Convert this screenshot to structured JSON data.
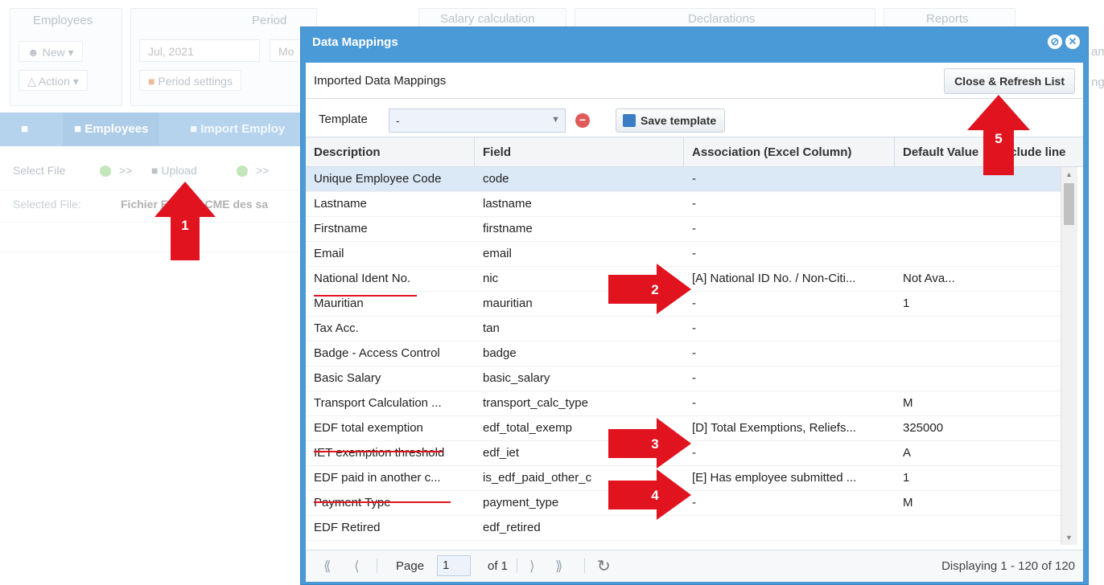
{
  "background": {
    "panels": {
      "employees": "Employees",
      "period": "Period",
      "salary_calculation": "Salary calculation",
      "declarations": "Declarations",
      "reports": "Reports"
    },
    "new_button": "New",
    "action_button": "Action",
    "period_value": "Jul, 2021",
    "period_mode": "Mo",
    "period_settings": "Period settings",
    "tabs": [
      "Employees",
      "Import Employ"
    ],
    "toolbar": {
      "select_file": "Select File",
      "sep1": ">>",
      "upload": "Upload",
      "sep2": ">>"
    },
    "selected_file_label": "Selected File:",
    "selected_file_value": "Fichier E... de ACME des sa",
    "right_edge_labels": [
      "am",
      "ng"
    ]
  },
  "modal": {
    "title": "Data Mappings",
    "subtitle": "Imported Data Mappings",
    "close_refresh_label": "Close & Refresh List",
    "template_label": "Template",
    "template_value": "-",
    "save_template_label": "Save template",
    "columns": [
      "Description",
      "Field",
      "Association (Excel Column)",
      "Default Value",
      "Include line"
    ],
    "rows": [
      {
        "description": "Unique Employee Code",
        "field": "code",
        "association": "-",
        "default": ""
      },
      {
        "description": "Lastname",
        "field": "lastname",
        "association": "-",
        "default": ""
      },
      {
        "description": "Firstname",
        "field": "firstname",
        "association": "-",
        "default": ""
      },
      {
        "description": "Email",
        "field": "email",
        "association": "-",
        "default": ""
      },
      {
        "description": "National Ident No.",
        "field": "nic",
        "association": "[A] National ID No. / Non-Citi...",
        "default": "Not Ava..."
      },
      {
        "description": "Mauritian",
        "field": "mauritian",
        "association": "-",
        "default": "1"
      },
      {
        "description": "Tax Acc.",
        "field": "tan",
        "association": "-",
        "default": ""
      },
      {
        "description": "Badge - Access Control",
        "field": "badge",
        "association": "-",
        "default": ""
      },
      {
        "description": "Basic Salary",
        "field": "basic_salary",
        "association": "-",
        "default": ""
      },
      {
        "description": "Transport Calculation ...",
        "field": "transport_calc_type",
        "association": "-",
        "default": "M"
      },
      {
        "description": "EDF total exemption",
        "field": "edf_total_exemp",
        "association": "[D] Total Exemptions, Reliefs...",
        "default": "325000"
      },
      {
        "description": "IET exemption threshold",
        "field": "edf_iet",
        "association": "-",
        "default": "A"
      },
      {
        "description": "EDF paid in another c...",
        "field": "is_edf_paid_other_c",
        "association": "[E] Has employee submitted ...",
        "default": "1"
      },
      {
        "description": "Payment Type",
        "field": "payment_type",
        "association": "-",
        "default": "M"
      },
      {
        "description": "EDF Retired",
        "field": "edf_retired",
        "association": "",
        "default": ""
      }
    ],
    "pager": {
      "page_label": "Page",
      "page_value": "1",
      "of_label": "of 1",
      "display_text": "Displaying 1 - 120 of 120"
    }
  },
  "annotations": [
    "1",
    "2",
    "3",
    "4",
    "5"
  ],
  "colors": {
    "modal_header": "#4b9ad8",
    "annotation_red": "#e0131f",
    "selected_row": "#dbe8f6"
  }
}
